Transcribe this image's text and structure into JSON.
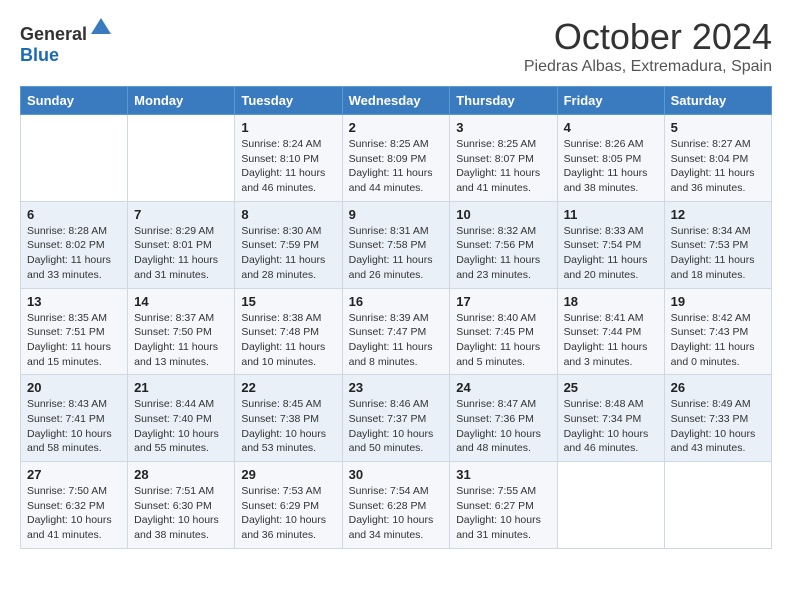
{
  "logo": {
    "text_general": "General",
    "text_blue": "Blue"
  },
  "title": "October 2024",
  "location": "Piedras Albas, Extremadura, Spain",
  "days_of_week": [
    "Sunday",
    "Monday",
    "Tuesday",
    "Wednesday",
    "Thursday",
    "Friday",
    "Saturday"
  ],
  "weeks": [
    [
      {
        "day": "",
        "info": ""
      },
      {
        "day": "",
        "info": ""
      },
      {
        "day": "1",
        "info": "Sunrise: 8:24 AM\nSunset: 8:10 PM\nDaylight: 11 hours and 46 minutes."
      },
      {
        "day": "2",
        "info": "Sunrise: 8:25 AM\nSunset: 8:09 PM\nDaylight: 11 hours and 44 minutes."
      },
      {
        "day": "3",
        "info": "Sunrise: 8:25 AM\nSunset: 8:07 PM\nDaylight: 11 hours and 41 minutes."
      },
      {
        "day": "4",
        "info": "Sunrise: 8:26 AM\nSunset: 8:05 PM\nDaylight: 11 hours and 38 minutes."
      },
      {
        "day": "5",
        "info": "Sunrise: 8:27 AM\nSunset: 8:04 PM\nDaylight: 11 hours and 36 minutes."
      }
    ],
    [
      {
        "day": "6",
        "info": "Sunrise: 8:28 AM\nSunset: 8:02 PM\nDaylight: 11 hours and 33 minutes."
      },
      {
        "day": "7",
        "info": "Sunrise: 8:29 AM\nSunset: 8:01 PM\nDaylight: 11 hours and 31 minutes."
      },
      {
        "day": "8",
        "info": "Sunrise: 8:30 AM\nSunset: 7:59 PM\nDaylight: 11 hours and 28 minutes."
      },
      {
        "day": "9",
        "info": "Sunrise: 8:31 AM\nSunset: 7:58 PM\nDaylight: 11 hours and 26 minutes."
      },
      {
        "day": "10",
        "info": "Sunrise: 8:32 AM\nSunset: 7:56 PM\nDaylight: 11 hours and 23 minutes."
      },
      {
        "day": "11",
        "info": "Sunrise: 8:33 AM\nSunset: 7:54 PM\nDaylight: 11 hours and 20 minutes."
      },
      {
        "day": "12",
        "info": "Sunrise: 8:34 AM\nSunset: 7:53 PM\nDaylight: 11 hours and 18 minutes."
      }
    ],
    [
      {
        "day": "13",
        "info": "Sunrise: 8:35 AM\nSunset: 7:51 PM\nDaylight: 11 hours and 15 minutes."
      },
      {
        "day": "14",
        "info": "Sunrise: 8:37 AM\nSunset: 7:50 PM\nDaylight: 11 hours and 13 minutes."
      },
      {
        "day": "15",
        "info": "Sunrise: 8:38 AM\nSunset: 7:48 PM\nDaylight: 11 hours and 10 minutes."
      },
      {
        "day": "16",
        "info": "Sunrise: 8:39 AM\nSunset: 7:47 PM\nDaylight: 11 hours and 8 minutes."
      },
      {
        "day": "17",
        "info": "Sunrise: 8:40 AM\nSunset: 7:45 PM\nDaylight: 11 hours and 5 minutes."
      },
      {
        "day": "18",
        "info": "Sunrise: 8:41 AM\nSunset: 7:44 PM\nDaylight: 11 hours and 3 minutes."
      },
      {
        "day": "19",
        "info": "Sunrise: 8:42 AM\nSunset: 7:43 PM\nDaylight: 11 hours and 0 minutes."
      }
    ],
    [
      {
        "day": "20",
        "info": "Sunrise: 8:43 AM\nSunset: 7:41 PM\nDaylight: 10 hours and 58 minutes."
      },
      {
        "day": "21",
        "info": "Sunrise: 8:44 AM\nSunset: 7:40 PM\nDaylight: 10 hours and 55 minutes."
      },
      {
        "day": "22",
        "info": "Sunrise: 8:45 AM\nSunset: 7:38 PM\nDaylight: 10 hours and 53 minutes."
      },
      {
        "day": "23",
        "info": "Sunrise: 8:46 AM\nSunset: 7:37 PM\nDaylight: 10 hours and 50 minutes."
      },
      {
        "day": "24",
        "info": "Sunrise: 8:47 AM\nSunset: 7:36 PM\nDaylight: 10 hours and 48 minutes."
      },
      {
        "day": "25",
        "info": "Sunrise: 8:48 AM\nSunset: 7:34 PM\nDaylight: 10 hours and 46 minutes."
      },
      {
        "day": "26",
        "info": "Sunrise: 8:49 AM\nSunset: 7:33 PM\nDaylight: 10 hours and 43 minutes."
      }
    ],
    [
      {
        "day": "27",
        "info": "Sunrise: 7:50 AM\nSunset: 6:32 PM\nDaylight: 10 hours and 41 minutes."
      },
      {
        "day": "28",
        "info": "Sunrise: 7:51 AM\nSunset: 6:30 PM\nDaylight: 10 hours and 38 minutes."
      },
      {
        "day": "29",
        "info": "Sunrise: 7:53 AM\nSunset: 6:29 PM\nDaylight: 10 hours and 36 minutes."
      },
      {
        "day": "30",
        "info": "Sunrise: 7:54 AM\nSunset: 6:28 PM\nDaylight: 10 hours and 34 minutes."
      },
      {
        "day": "31",
        "info": "Sunrise: 7:55 AM\nSunset: 6:27 PM\nDaylight: 10 hours and 31 minutes."
      },
      {
        "day": "",
        "info": ""
      },
      {
        "day": "",
        "info": ""
      }
    ]
  ]
}
